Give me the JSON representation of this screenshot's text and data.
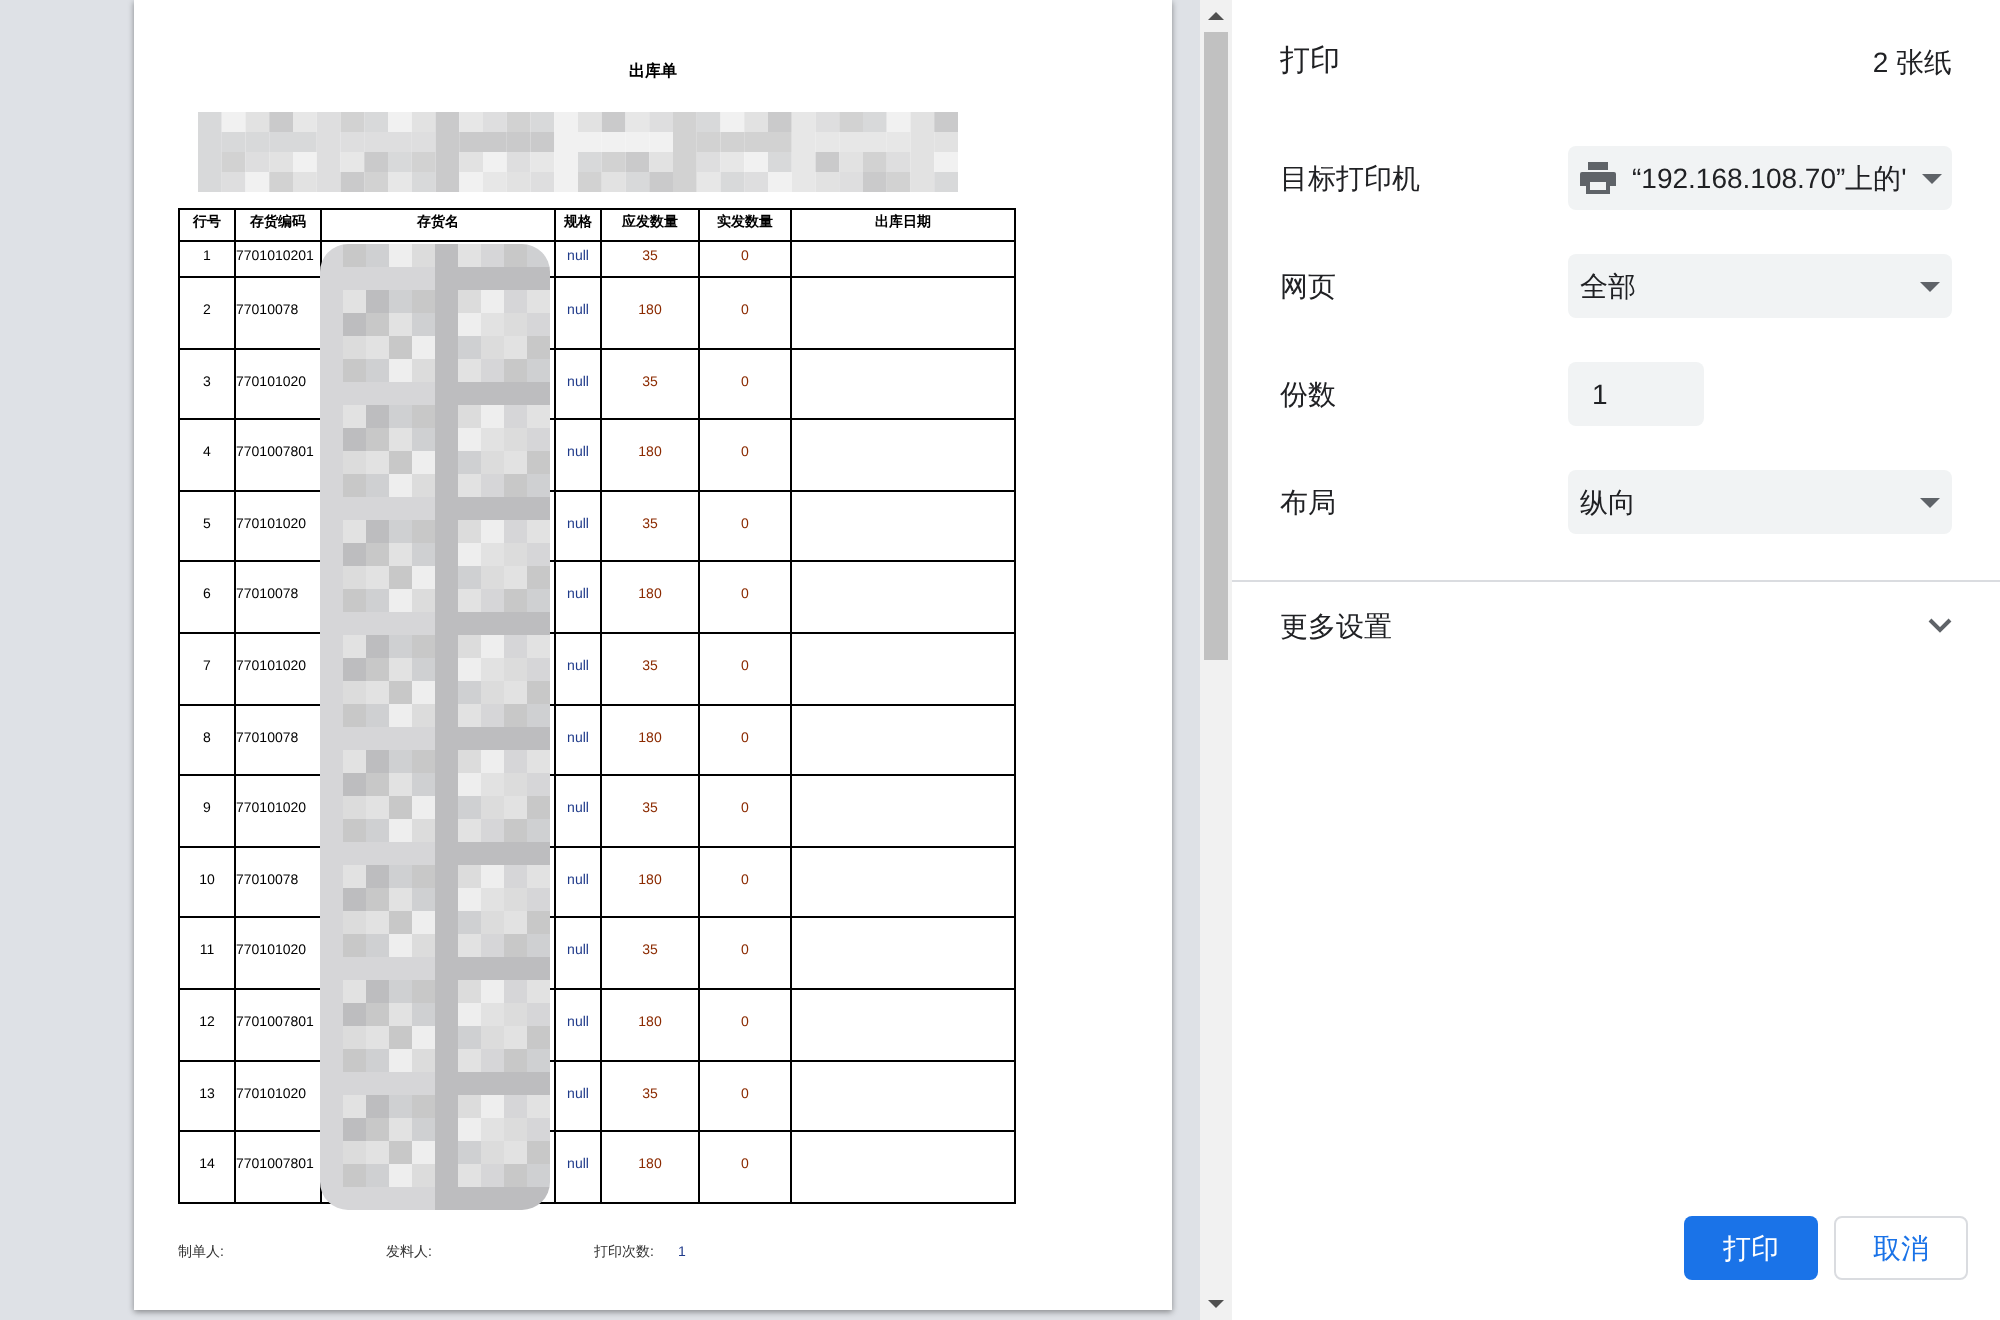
{
  "document": {
    "title": "出库单",
    "columns": [
      "行号",
      "存货编码",
      "存货名",
      "规格",
      "应发数量",
      "实发数量",
      "出库日期"
    ],
    "rows": [
      {
        "no": "1",
        "code": "7701010201",
        "spec": "null",
        "due": "35",
        "actual": "0"
      },
      {
        "no": "2",
        "code": "77010078",
        "spec": "null",
        "due": "180",
        "actual": "0"
      },
      {
        "no": "3",
        "code": "770101020",
        "spec": "null",
        "due": "35",
        "actual": "0"
      },
      {
        "no": "4",
        "code": "7701007801",
        "spec": "null",
        "due": "180",
        "actual": "0"
      },
      {
        "no": "5",
        "code": "770101020",
        "spec": "null",
        "due": "35",
        "actual": "0"
      },
      {
        "no": "6",
        "code": "77010078",
        "spec": "null",
        "due": "180",
        "actual": "0"
      },
      {
        "no": "7",
        "code": "770101020",
        "spec": "null",
        "due": "35",
        "actual": "0"
      },
      {
        "no": "8",
        "code": "77010078",
        "spec": "null",
        "due": "180",
        "actual": "0"
      },
      {
        "no": "9",
        "code": "770101020",
        "spec": "null",
        "due": "35",
        "actual": "0"
      },
      {
        "no": "10",
        "code": "77010078",
        "spec": "null",
        "due": "180",
        "actual": "0"
      },
      {
        "no": "11",
        "code": "770101020",
        "spec": "null",
        "due": "35",
        "actual": "0"
      },
      {
        "no": "12",
        "code": "7701007801",
        "spec": "null",
        "due": "180",
        "actual": "0"
      },
      {
        "no": "13",
        "code": "770101020",
        "spec": "null",
        "due": "35",
        "actual": "0"
      },
      {
        "no": "14",
        "code": "7701007801",
        "spec": "null",
        "due": "180",
        "actual": "0"
      }
    ],
    "footer": [
      {
        "label": "制单人:"
      },
      {
        "label": "发料人:"
      },
      {
        "label": "打印次数:",
        "value": "1"
      }
    ]
  },
  "panel": {
    "title": "打印",
    "sheets": "2 张纸",
    "settings": [
      {
        "label": "目标打印机",
        "kind": "select",
        "value": "“192.168.108.70”上的'"
      },
      {
        "label": "网页",
        "kind": "select",
        "value": "全部"
      },
      {
        "label": "份数",
        "kind": "input",
        "value": "1"
      },
      {
        "label": "布局",
        "kind": "select",
        "value": "纵向"
      }
    ],
    "more": {
      "label": "更多设置",
      "expanded": false
    },
    "buttons": [
      {
        "label": "打印",
        "kind": "primary"
      },
      {
        "label": "取消",
        "kind": "secondary"
      }
    ]
  }
}
